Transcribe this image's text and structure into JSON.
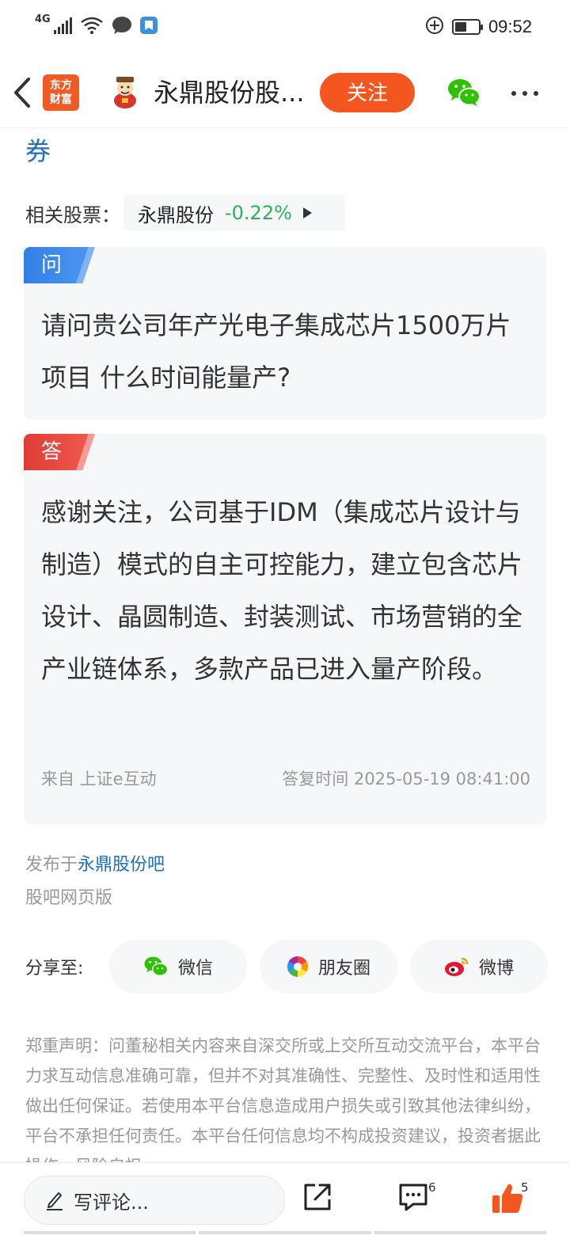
{
  "status_bar": {
    "network": "4G",
    "time": "09:52",
    "battery_percent": 40
  },
  "header": {
    "brand_logo_text": "东方\n财富",
    "title": "永鼎股份股...",
    "follow_label": "关注"
  },
  "content": {
    "title_tail": "券",
    "related_label": "相关股票：",
    "stock": {
      "name": "永鼎股份",
      "change": "-0.22%"
    }
  },
  "question": {
    "tag": "问",
    "text": "请问贵公司年产光电子集成芯片1500万片项目 什么时间能量产?"
  },
  "answer": {
    "tag": "答",
    "text": "感谢关注，公司基于IDM（集成芯片设计与制造）模式的自主可控能力，建立包含芯片设计、晶圆制造、封装测试、市场营销的全产业链体系，多款产品已进入量产阶段。",
    "source": "来自 上证e互动",
    "reply_time": "答复时间 2025-05-19 08:41:00"
  },
  "published": {
    "prefix": "发布于",
    "link": "永鼎股份吧",
    "web_version": "股吧网页版"
  },
  "share": {
    "label": "分享至:",
    "targets": [
      {
        "label": "微信",
        "icon": "wechat-icon"
      },
      {
        "label": "朋友圈",
        "icon": "moments-icon"
      },
      {
        "label": "微博",
        "icon": "weibo-icon"
      }
    ]
  },
  "disclaimer": "郑重声明：问董秘相关内容来自深交所或上交所互动交流平台，本平台力求互动信息准确可靠，但并不对其准确性、完整性、及时性和适用性做出任何保证。若使用本平台信息造成用户损失或引致其他法律纠纷，平台不承担任何责任。本平台任何信息均不构成投资建议，投资者据此操作，风险自担。",
  "bottom_bar": {
    "comment_placeholder": "写评论...",
    "comment_count": "6",
    "like_count": "5"
  },
  "colors": {
    "accent_orange": "#f5561f",
    "link_blue": "#1e6fbf",
    "stock_green": "#2eb05a",
    "like_orange": "#f5561f"
  }
}
